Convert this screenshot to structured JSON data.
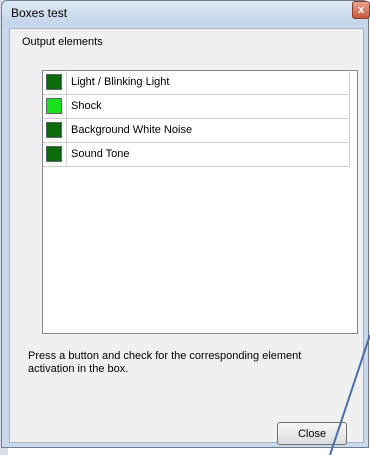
{
  "window": {
    "title": "Boxes test",
    "close_glyph": "x"
  },
  "group": {
    "label": "Output elements"
  },
  "outputs": [
    {
      "name": "Light / Blinking Light",
      "state": "off",
      "color": "#0b6b0b"
    },
    {
      "name": "Shock",
      "state": "on",
      "color": "#1be01b"
    },
    {
      "name": "Background White Noise",
      "state": "off",
      "color": "#0b6b0b"
    },
    {
      "name": "Sound Tone",
      "state": "off",
      "color": "#0b6b0b"
    }
  ],
  "hint": "Press a button and check for the corresponding element activation in the box.",
  "buttons": {
    "close_label": "Close"
  },
  "colors": {
    "led_off": "#0b6b0b",
    "led_on": "#1be01b",
    "annotation_line": "#4a6fa8"
  }
}
